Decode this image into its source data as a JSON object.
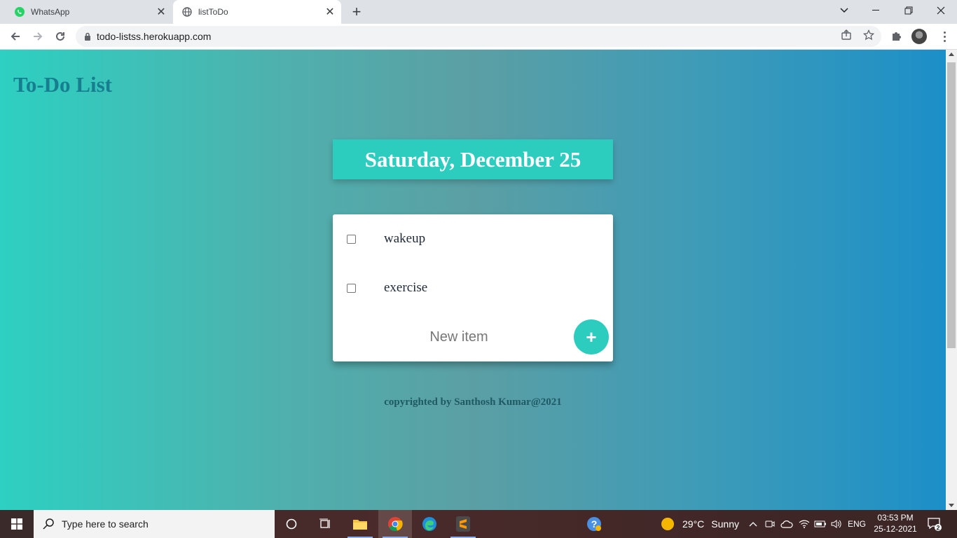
{
  "browser": {
    "tabs": [
      {
        "title": "WhatsApp",
        "favicon": "whatsapp-icon",
        "active": false
      },
      {
        "title": "listToDo",
        "favicon": "globe-icon",
        "active": true
      }
    ],
    "url": "todo-listss.herokuapp.com"
  },
  "page": {
    "title": "To-Do List",
    "date_heading": "Saturday, December 25",
    "items": [
      {
        "label": "wakeup",
        "checked": false
      },
      {
        "label": "exercise",
        "checked": false
      }
    ],
    "new_item_placeholder": "New item",
    "add_button_label": "+",
    "footer": "copyrighted by Santhosh Kumar@2021",
    "colors": {
      "accent": "#2ccdbf",
      "title": "#167e8f",
      "gradient_start": "#2dd0c2",
      "gradient_end": "#1c8fc8"
    }
  },
  "taskbar": {
    "search_placeholder": "Type here to search",
    "weather_temp": "29°C",
    "weather_desc": "Sunny",
    "language": "ENG",
    "time": "03:53 PM",
    "date": "25-12-2021",
    "notification_count": "2"
  }
}
